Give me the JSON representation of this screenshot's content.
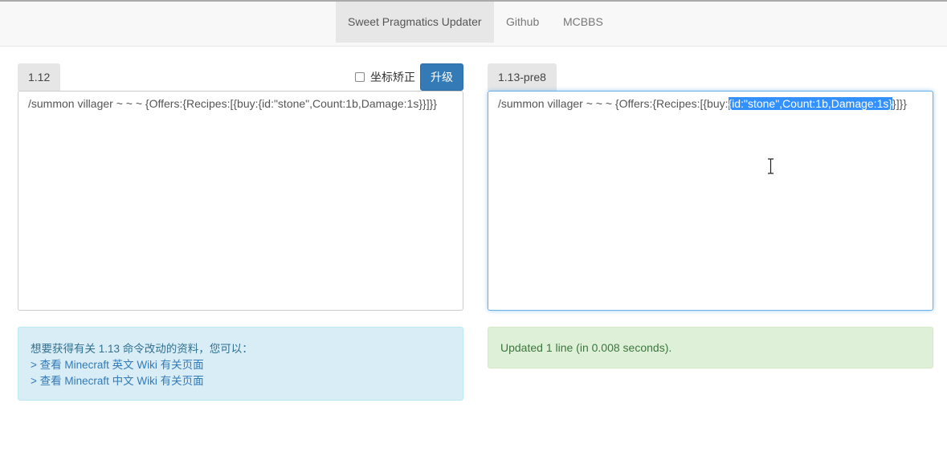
{
  "navbar": {
    "brand": "Sweet Pragmatics Updater",
    "links": [
      "Github",
      "MCBBS"
    ]
  },
  "left": {
    "version_tab": "1.12",
    "checkbox_label": "坐标矫正",
    "checkbox_checked": false,
    "upgrade_button": "升级",
    "command": "/summon villager ~ ~ ~ {Offers:{Recipes:[{buy:{id:\"stone\",Count:1b,Damage:1s}}]}}"
  },
  "right": {
    "version_tab": "1.13-pre8",
    "command_prefix": "/summon villager ~ ~ ~ {Offers:{Recipes:[{buy:",
    "command_selected": "{id:\"stone\",Count:1b,Damage:1s}",
    "command_suffix": "}]}}"
  },
  "info": {
    "intro": "想要获得有关 1.13 命令改动的资料，您可以：",
    "link_en": "> 查看 Minecraft 英文 Wiki 有关页面",
    "link_zh": "> 查看 Minecraft 中文 Wiki 有关页面"
  },
  "status": {
    "message": "Updated 1 line (in 0.008 seconds)."
  },
  "icons": {
    "mouse_cursor": "ibeam-cursor-icon"
  },
  "colors": {
    "primary": "#337ab7",
    "selection": "#3390ff",
    "info_bg": "#d9edf7",
    "success_bg": "#dff0d8"
  }
}
